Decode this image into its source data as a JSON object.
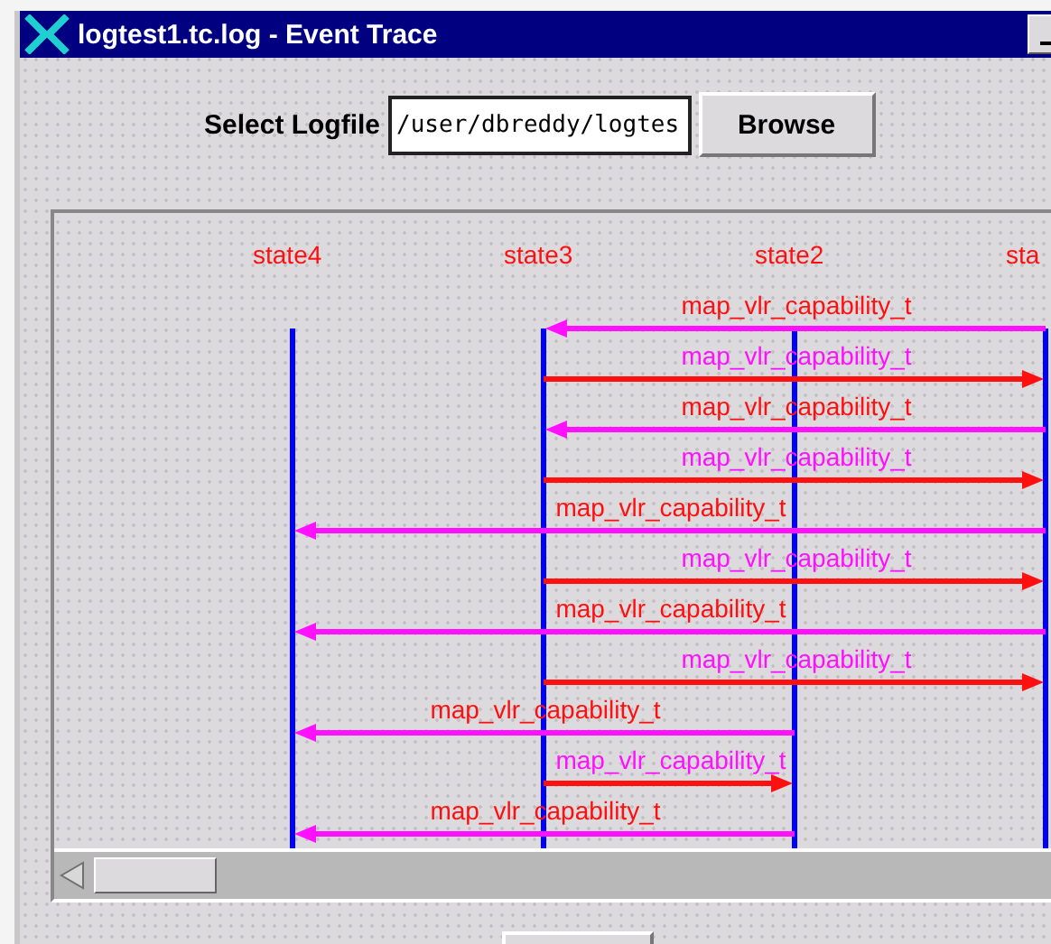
{
  "window": {
    "title": "logtest1.tc.log - Event Trace"
  },
  "logfile": {
    "label": "Select Logfile",
    "value": "/user/dbreddy/logtes",
    "button": "Browse"
  },
  "lanes": [
    "state4",
    "state3",
    "state2",
    "sta"
  ],
  "messages": [
    {
      "text": "map_vlr_capability_t"
    },
    {
      "text": "map_vlr_capability_t"
    },
    {
      "text": "map_vlr_capability_t"
    },
    {
      "text": "map_vlr_capability_t"
    },
    {
      "text": "map_vlr_capability_t"
    },
    {
      "text": "map_vlr_capability_t"
    },
    {
      "text": "map_vlr_capability_t"
    },
    {
      "text": "map_vlr_capability_t"
    },
    {
      "text": "map_vlr_capability_t"
    },
    {
      "text": "map_vlr_capability_t"
    },
    {
      "text": "map_vlr_capability_t"
    }
  ]
}
